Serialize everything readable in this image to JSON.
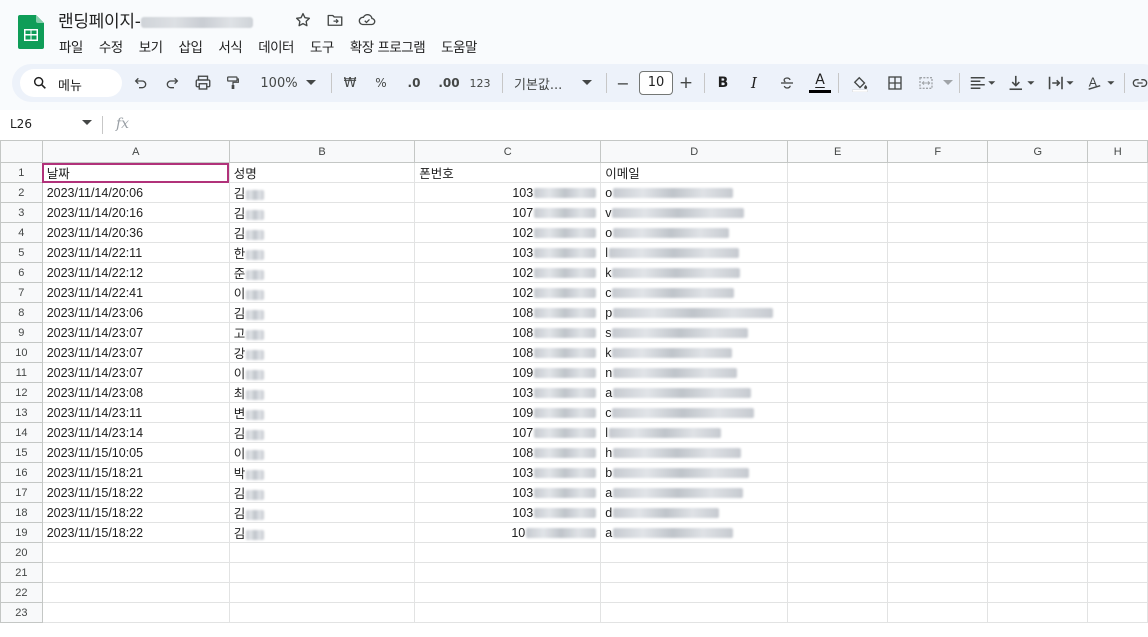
{
  "document": {
    "title": "랜딩페이지-",
    "title_suffix_redacted": true
  },
  "menu": [
    "파일",
    "수정",
    "보기",
    "삽입",
    "서식",
    "데이터",
    "도구",
    "확장 프로그램",
    "도움말"
  ],
  "toolbar": {
    "search_label": "메뉴",
    "zoom": "100%",
    "currency": "₩",
    "percent": "%",
    "decrease_decimal": ".0",
    "increase_decimal": ".00",
    "number_format": "123",
    "font_name": "기본값...",
    "font_size": "10",
    "minus": "−",
    "plus": "+",
    "bold": "B",
    "italic": "I",
    "text_color_glyph": "A",
    "accent_color": "#b1327a"
  },
  "formula_bar": {
    "cell_ref": "L26",
    "fx": "fx"
  },
  "grid": {
    "columns": [
      "A",
      "B",
      "C",
      "D",
      "E",
      "F",
      "G",
      "H"
    ],
    "rows": [
      {
        "n": "1",
        "a": "날짜",
        "b": "성명",
        "c": "폰번호",
        "d": "이메일"
      },
      {
        "n": "2",
        "a": "2023/11/14/20:06",
        "b": "김",
        "c": "103",
        "d": "o"
      },
      {
        "n": "3",
        "a": "2023/11/14/20:16",
        "b": "김",
        "c": "107",
        "d": "v"
      },
      {
        "n": "4",
        "a": "2023/11/14/20:36",
        "b": "김",
        "c": "102",
        "d": "o"
      },
      {
        "n": "5",
        "a": "2023/11/14/22:11",
        "b": "한",
        "c": "103",
        "d": "l"
      },
      {
        "n": "6",
        "a": "2023/11/14/22:12",
        "b": "준",
        "c": "102",
        "d": "k"
      },
      {
        "n": "7",
        "a": "2023/11/14/22:41",
        "b": "이",
        "c": "102",
        "d": "c"
      },
      {
        "n": "8",
        "a": "2023/11/14/23:06",
        "b": "김",
        "c": "108",
        "d": "p"
      },
      {
        "n": "9",
        "a": "2023/11/14/23:07",
        "b": "고",
        "c": "108",
        "d": "s"
      },
      {
        "n": "10",
        "a": "2023/11/14/23:07",
        "b": "강",
        "c": "108",
        "d": "k"
      },
      {
        "n": "11",
        "a": "2023/11/14/23:07",
        "b": "이",
        "c": "109",
        "d": "n"
      },
      {
        "n": "12",
        "a": "2023/11/14/23:08",
        "b": "최",
        "c": "103",
        "d": "a"
      },
      {
        "n": "13",
        "a": "2023/11/14/23:11",
        "b": "변",
        "c": "109",
        "d": "c"
      },
      {
        "n": "14",
        "a": "2023/11/14/23:14",
        "b": "김",
        "c": "107",
        "d": "l"
      },
      {
        "n": "15",
        "a": "2023/11/15/10:05",
        "b": "이",
        "c": "108",
        "d": "h"
      },
      {
        "n": "16",
        "a": "2023/11/15/18:21",
        "b": "박",
        "c": "103",
        "d": "b"
      },
      {
        "n": "17",
        "a": "2023/11/15/18:22",
        "b": "김",
        "c": "103",
        "d": "a"
      },
      {
        "n": "18",
        "a": "2023/11/15/18:22",
        "b": "김",
        "c": "103",
        "d": "d"
      },
      {
        "n": "19",
        "a": "2023/11/15/18:22",
        "b": "김",
        "c": "10",
        "d": "a"
      },
      {
        "n": "20",
        "a": "",
        "b": "",
        "c": "",
        "d": ""
      },
      {
        "n": "21",
        "a": "",
        "b": "",
        "c": "",
        "d": ""
      },
      {
        "n": "22",
        "a": "",
        "b": "",
        "c": "",
        "d": ""
      },
      {
        "n": "23",
        "a": "",
        "b": "",
        "c": "",
        "d": ""
      }
    ]
  }
}
